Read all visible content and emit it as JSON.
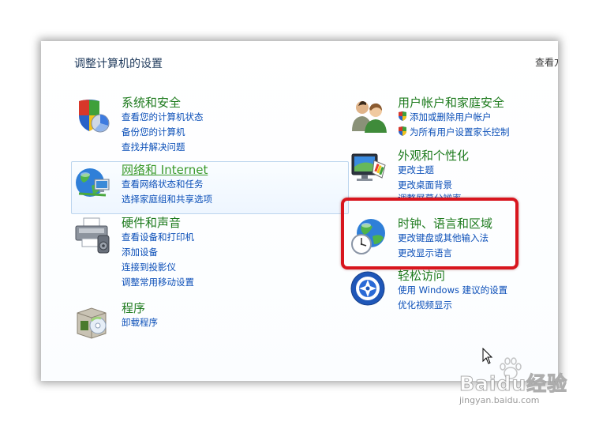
{
  "page": {
    "title": "调整计算机的设置",
    "view_by": "查看方"
  },
  "categories": {
    "system_security": {
      "title": "系统和安全",
      "links": [
        "查看您的计算机状态",
        "备份您的计算机",
        "查找并解决问题"
      ],
      "icon": "shield-security-icon"
    },
    "network_internet": {
      "title": "网络和 Internet",
      "links": [
        "查看网络状态和任务",
        "选择家庭组和共享选项"
      ],
      "icon": "network-globe-icon"
    },
    "hardware_sound": {
      "title": "硬件和声音",
      "links": [
        "查看设备和打印机",
        "添加设备",
        "连接到投影仪",
        "调整常用移动设置"
      ],
      "icon": "printer-icon"
    },
    "programs": {
      "title": "程序",
      "links": [
        "卸载程序"
      ],
      "icon": "programs-box-icon"
    },
    "user_accounts": {
      "title": "用户帐户和家庭安全",
      "links": [
        "添加或删除用户帐户",
        "为所有用户设置家长控制"
      ],
      "icon": "users-icon"
    },
    "appearance": {
      "title": "外观和个性化",
      "links": [
        "更改主题",
        "更改桌面背景",
        "调整屏幕分辨率"
      ],
      "icon": "monitor-palette-icon"
    },
    "clock_region": {
      "title": "时钟、语言和区域",
      "links": [
        "更改键盘或其他输入法",
        "更改显示语言"
      ],
      "icon": "clock-globe-icon"
    },
    "ease_access": {
      "title": "轻松访问",
      "links": [
        "使用 Windows 建议的设置",
        "优化视频显示"
      ],
      "icon": "ease-of-access-icon"
    }
  },
  "watermark": {
    "brand": "Baidu经验",
    "url": "jingyan.baidu.com"
  },
  "colors": {
    "title_green": "#1e7b1e",
    "link_blue": "#0b4fb8",
    "highlight_red": "#d8161e"
  }
}
